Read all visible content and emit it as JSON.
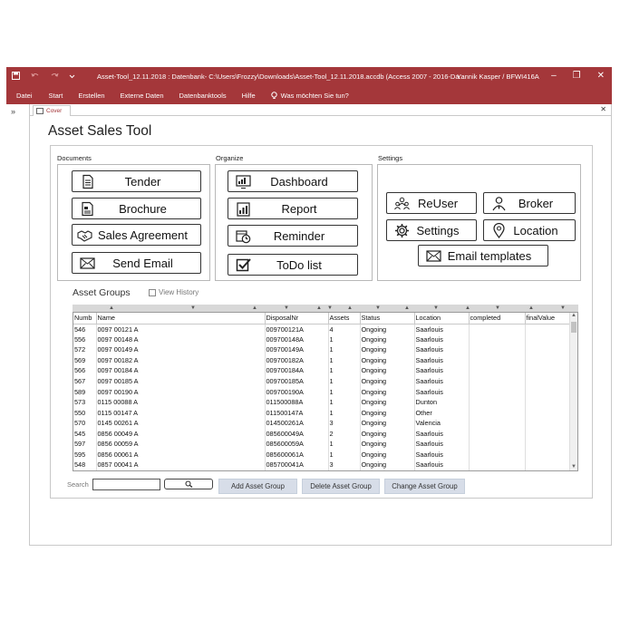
{
  "window": {
    "title": "Asset-Tool_12.11.2018 : Datenbank- C:\\Users\\Frozzy\\Downloads\\Asset-Tool_12.11.2018.accdb (Access 2007 - 2016-Da...",
    "user": "Yannik Kasper / BFWI416A",
    "accent_color": "#a4373a"
  },
  "ribbon": {
    "items": [
      "Datei",
      "Start",
      "Erstellen",
      "Externe Daten",
      "Datenbanktools",
      "Hilfe"
    ],
    "tell_me": "Was möchten Sie tun?"
  },
  "tabs": [
    {
      "label": "Cover"
    }
  ],
  "form": {
    "title": "Asset Sales Tool",
    "sections": {
      "documents": "Documents",
      "organize": "Organize",
      "settings": "Settings"
    },
    "buttons": {
      "tender": "Tender",
      "brochure": "Brochure",
      "sales_agreement": "Sales Agreement",
      "send_email": "Send Email",
      "dashboard": "Dashboard",
      "report": "Report",
      "reminder": "Reminder",
      "todo": "ToDo list",
      "reuser": "ReUser",
      "broker": "Broker",
      "settings": "Settings",
      "location": "Location",
      "email_templates": "Email templates"
    },
    "asset_groups_label": "Asset Groups",
    "view_history_label": "View History"
  },
  "table": {
    "columns": [
      "Numb",
      "Name",
      "DisposalNr",
      "Assets",
      "Status",
      "Location",
      "completed",
      "finalValue"
    ],
    "rows": [
      [
        "546",
        "0097 00121 A",
        "009700121A",
        "4",
        "Ongoing",
        "Saarlouis",
        "",
        ""
      ],
      [
        "556",
        "0097 00148 A",
        "009700148A",
        "1",
        "Ongoing",
        "Saarlouis",
        "",
        ""
      ],
      [
        "572",
        "0097 00149 A",
        "009700149A",
        "1",
        "Ongoing",
        "Saarlouis",
        "",
        ""
      ],
      [
        "569",
        "0097 00182 A",
        "009700182A",
        "1",
        "Ongoing",
        "Saarlouis",
        "",
        ""
      ],
      [
        "566",
        "0097 00184 A",
        "009700184A",
        "1",
        "Ongoing",
        "Saarlouis",
        "",
        ""
      ],
      [
        "567",
        "0097 00185 A",
        "009700185A",
        "1",
        "Ongoing",
        "Saarlouis",
        "",
        ""
      ],
      [
        "589",
        "0097 00190 A",
        "009700190A",
        "1",
        "Ongoing",
        "Saarlouis",
        "",
        ""
      ],
      [
        "573",
        "0115 00088 A",
        "011500088A",
        "1",
        "Ongoing",
        "Dunton",
        "",
        ""
      ],
      [
        "550",
        "0115 00147 A",
        "011500147A",
        "1",
        "Ongoing",
        "Other",
        "",
        ""
      ],
      [
        "570",
        "0145 00261 A",
        "014500261A",
        "3",
        "Ongoing",
        "Valencia",
        "",
        ""
      ],
      [
        "545",
        "0856 00049 A",
        "085600049A",
        "2",
        "Ongoing",
        "Saarlouis",
        "",
        ""
      ],
      [
        "597",
        "0856 00059 A",
        "085600059A",
        "1",
        "Ongoing",
        "Saarlouis",
        "",
        ""
      ],
      [
        "595",
        "0856 00061 A",
        "085600061A",
        "1",
        "Ongoing",
        "Saarlouis",
        "",
        ""
      ],
      [
        "548",
        "0857 00041 A",
        "085700041A",
        "3",
        "Ongoing",
        "Saarlouis",
        "",
        ""
      ]
    ]
  },
  "search": {
    "label": "Search",
    "value": ""
  },
  "actions": {
    "add": "Add Asset Group",
    "delete": "Delete Asset Group",
    "change": "Change Asset Group"
  }
}
